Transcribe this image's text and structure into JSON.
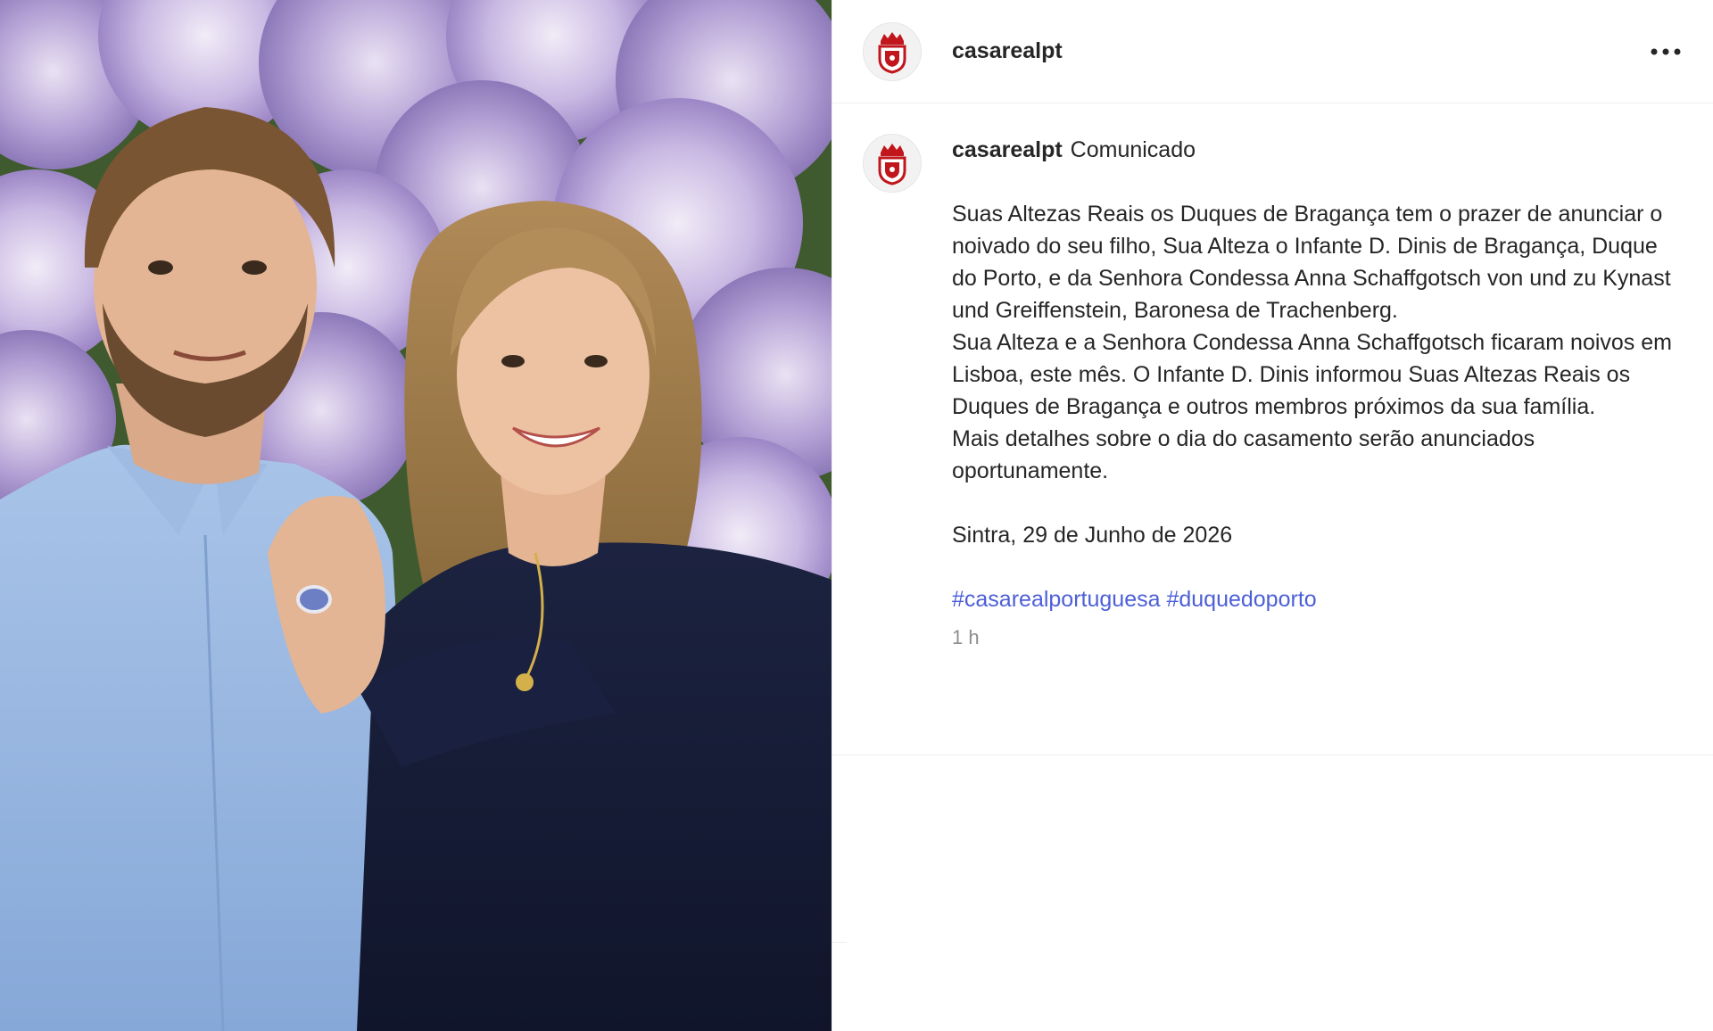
{
  "photo": {
    "description_icon": "photo-couple-hydrangeas"
  },
  "header": {
    "username": "casarealpt",
    "avatar_icon": "royal-coat-of-arms-icon",
    "more_icon": "more-horizontal-icon"
  },
  "caption": {
    "username": "casarealpt",
    "title": "Comunicado",
    "paragraphs": [
      "Suas Altezas Reais os Duques de Bragança tem o prazer de anunciar o noivado do seu filho, Sua Alteza o Infante D. Dinis de Bragança, Duque do Porto, e da Senhora Condessa Anna Schaffgotsch von und zu Kynast und Greiffenstein, Baronesa de Trachenberg.",
      "Sua Alteza e a Senhora Condessa Anna Schaffgotsch ficaram noivos em Lisboa, este mês. O Infante D. Dinis informou Suas Altezas Reais os Duques de Bragança e outros membros próximos da sua família.",
      "Mais detalhes sobre o dia do casamento serão anunciados oportunamente."
    ],
    "date_line": "Sintra, 29 de Junho de 2026",
    "hashtags": [
      "#casarealportuguesa",
      "#duquedoporto"
    ],
    "time": "1 h"
  },
  "colors": {
    "hashtag": "#4c5fd7",
    "text": "#262626",
    "muted": "#8e8e8e",
    "crest_red": "#c0161c"
  }
}
